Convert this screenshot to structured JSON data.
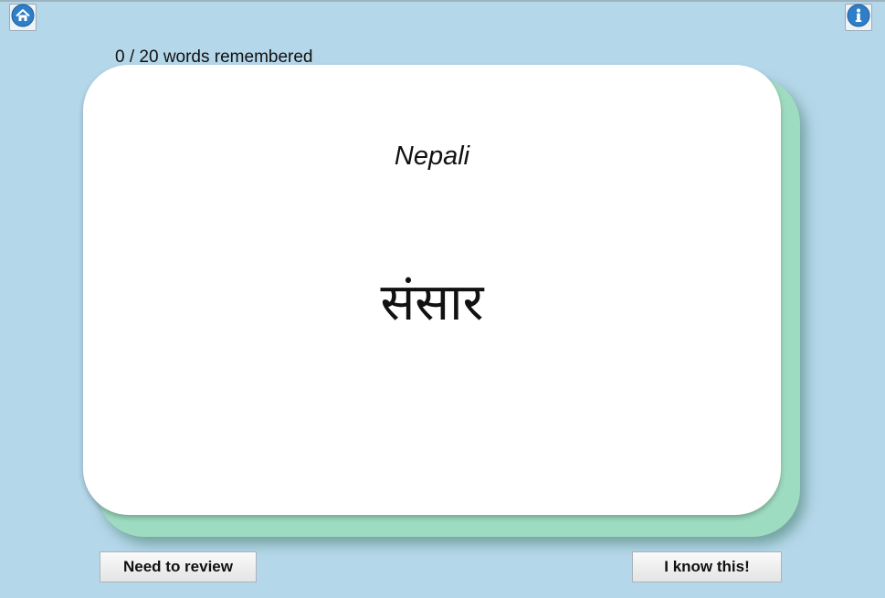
{
  "toolbar": {
    "home_icon": "home-icon",
    "info_icon": "info-icon",
    "icon_color": "#2f7fc8"
  },
  "progress": {
    "text": "0 / 20 words remembered",
    "remembered": 0,
    "total": 20
  },
  "card": {
    "language": "Nepali",
    "word": "संसार"
  },
  "actions": {
    "review_label": "Need to review",
    "know_label": "I know this!"
  }
}
